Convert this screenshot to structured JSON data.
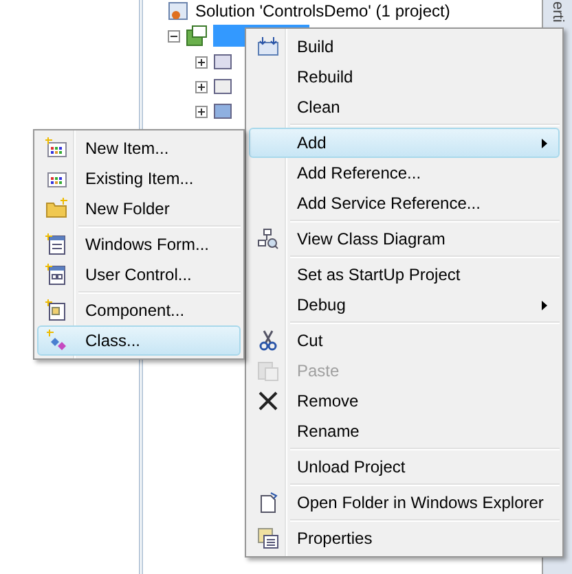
{
  "side_tab": {
    "label": "erti"
  },
  "tree": {
    "solution": "Solution 'ControlsDemo' (1 project)",
    "project": {
      "selected": true,
      "expanded": true
    },
    "children": [
      {
        "kind": "props",
        "expanded": false
      },
      {
        "kind": "refs",
        "expanded": false
      },
      {
        "kind": "form",
        "expanded": false
      }
    ]
  },
  "context_menu": {
    "items": [
      {
        "kind": "item",
        "label": "Build",
        "selected": false,
        "disabled": false
      },
      {
        "kind": "item",
        "label": "Rebuild",
        "selected": false,
        "disabled": false
      },
      {
        "kind": "item",
        "label": "Clean",
        "selected": false,
        "disabled": false
      },
      {
        "kind": "separator"
      },
      {
        "kind": "submenu",
        "label": "Add",
        "selected": true,
        "disabled": false
      },
      {
        "kind": "item",
        "label": "Add Reference...",
        "selected": false,
        "disabled": false
      },
      {
        "kind": "item",
        "label": "Add Service Reference...",
        "selected": false,
        "disabled": false
      },
      {
        "kind": "separator"
      },
      {
        "kind": "item",
        "label": "View Class Diagram",
        "selected": false,
        "disabled": false
      },
      {
        "kind": "separator"
      },
      {
        "kind": "item",
        "label": "Set as StartUp Project",
        "selected": false,
        "disabled": false
      },
      {
        "kind": "submenu",
        "label": "Debug",
        "selected": false,
        "disabled": false
      },
      {
        "kind": "separator"
      },
      {
        "kind": "item",
        "label": "Cut",
        "selected": false,
        "disabled": false
      },
      {
        "kind": "item",
        "label": "Paste",
        "selected": false,
        "disabled": true
      },
      {
        "kind": "item",
        "label": "Remove",
        "selected": false,
        "disabled": false
      },
      {
        "kind": "item",
        "label": "Rename",
        "selected": false,
        "disabled": false
      },
      {
        "kind": "separator"
      },
      {
        "kind": "item",
        "label": "Unload Project",
        "selected": false,
        "disabled": false
      },
      {
        "kind": "separator"
      },
      {
        "kind": "item",
        "label": "Open Folder in Windows Explorer",
        "selected": false,
        "disabled": false
      },
      {
        "kind": "separator"
      },
      {
        "kind": "item",
        "label": "Properties",
        "selected": false,
        "disabled": false
      }
    ]
  },
  "add_submenu": {
    "items": [
      {
        "kind": "item",
        "label": "New Item...",
        "selected": false,
        "disabled": false
      },
      {
        "kind": "item",
        "label": "Existing Item...",
        "selected": false,
        "disabled": false
      },
      {
        "kind": "item",
        "label": "New Folder",
        "selected": false,
        "disabled": false
      },
      {
        "kind": "separator"
      },
      {
        "kind": "item",
        "label": "Windows Form...",
        "selected": false,
        "disabled": false
      },
      {
        "kind": "item",
        "label": "User Control...",
        "selected": false,
        "disabled": false
      },
      {
        "kind": "separator"
      },
      {
        "kind": "item",
        "label": "Component...",
        "selected": false,
        "disabled": false
      },
      {
        "kind": "item",
        "label": "Class...",
        "selected": true,
        "disabled": false
      }
    ]
  }
}
